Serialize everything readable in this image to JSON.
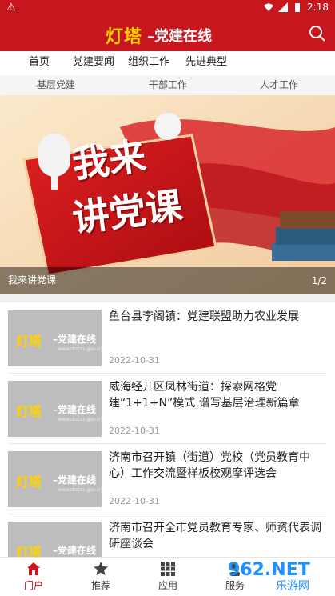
{
  "status_bar": {
    "time": "2:18",
    "alert_glyph": "⚠"
  },
  "header": {
    "logo_text": "灯塔",
    "title": "–党建在线",
    "search_icon": "search-icon"
  },
  "tabs": [
    {
      "label": "首页"
    },
    {
      "label": "党建要闻"
    },
    {
      "label": "组织工作"
    },
    {
      "label": "先进典型"
    }
  ],
  "subtabs": [
    {
      "label": "基层党建"
    },
    {
      "label": "干部工作"
    },
    {
      "label": "人才工作"
    }
  ],
  "banner": {
    "big_text_1": "我来",
    "big_text_2": "讲党课",
    "caption": "我来讲党课",
    "page": "1/2"
  },
  "news": [
    {
      "title": "鱼台县李阁镇：党建联盟助力农业发展",
      "date": "2022-10-31"
    },
    {
      "title": "威海经开区凤林街道：探索网格党建“1+1+N”模式 谱写基层治理新篇章",
      "date": "2022-10-31"
    },
    {
      "title": "济南市召开镇（街道）党校（党员教育中心）工作交流暨样板校观摩评选会",
      "date": "2022-10-31"
    },
    {
      "title": "济南市召开全市党员教育专家、师资代表调研座谈会",
      "date": ""
    }
  ],
  "thumb": {
    "logo": "灯塔",
    "sub": "–党建在线",
    "url": "www.dtdjzx.gov.cn"
  },
  "bottom_nav": [
    {
      "label": "门户",
      "icon": "home-icon",
      "active": true
    },
    {
      "label": "推荐",
      "icon": "star-icon",
      "active": false
    },
    {
      "label": "应用",
      "icon": "grid-icon",
      "active": false
    },
    {
      "label": "服务",
      "icon": "service-icon",
      "active": false
    }
  ],
  "watermark": {
    "main": "962.NET",
    "site": "乐游网"
  },
  "colors": {
    "brand_red": "#c8161e",
    "logo_yellow": "#ffd200",
    "watermark_blue": "#1e90ff"
  }
}
